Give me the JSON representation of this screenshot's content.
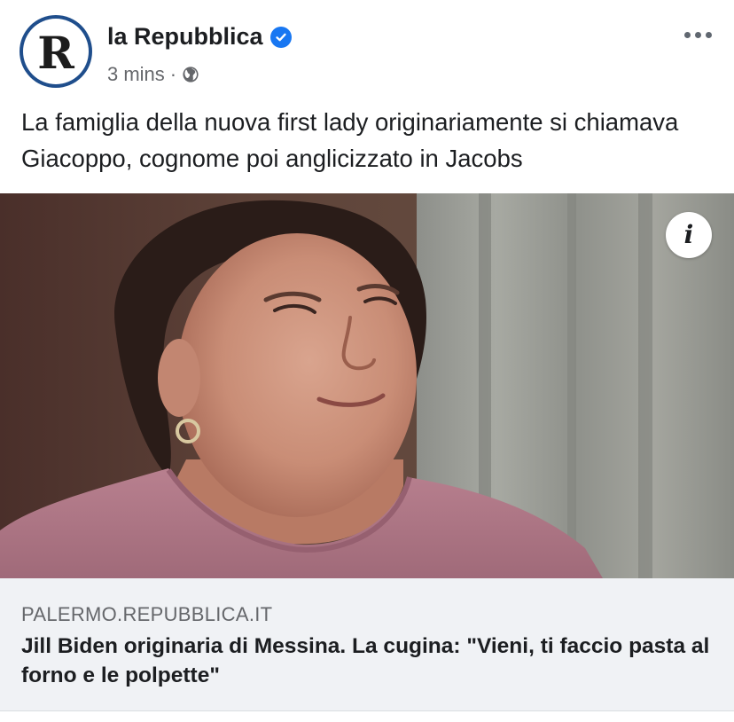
{
  "post": {
    "page_name": "la Repubblica",
    "avatar_letter": "R",
    "timestamp": "3 mins",
    "separator": "·",
    "audience_icon": "globe-icon",
    "verified_icon": "verified-badge-icon",
    "more_icon": "more-options-icon",
    "caption": "La famiglia della nuova first lady originariamente si chiamava Giacoppo, cognome poi anglicizzato in Jacobs"
  },
  "media": {
    "info_label": "i"
  },
  "link": {
    "domain": "PALERMO.REPUBBLICA.IT",
    "title": "Jill Biden originaria di Messina. La cugina: \"Vieni, ti faccio pasta al forno e le polpette\""
  },
  "colors": {
    "brand_blue": "#1877f2",
    "text_primary": "#1c1e21",
    "text_secondary": "#65676b",
    "card_background": "#f0f2f5"
  }
}
